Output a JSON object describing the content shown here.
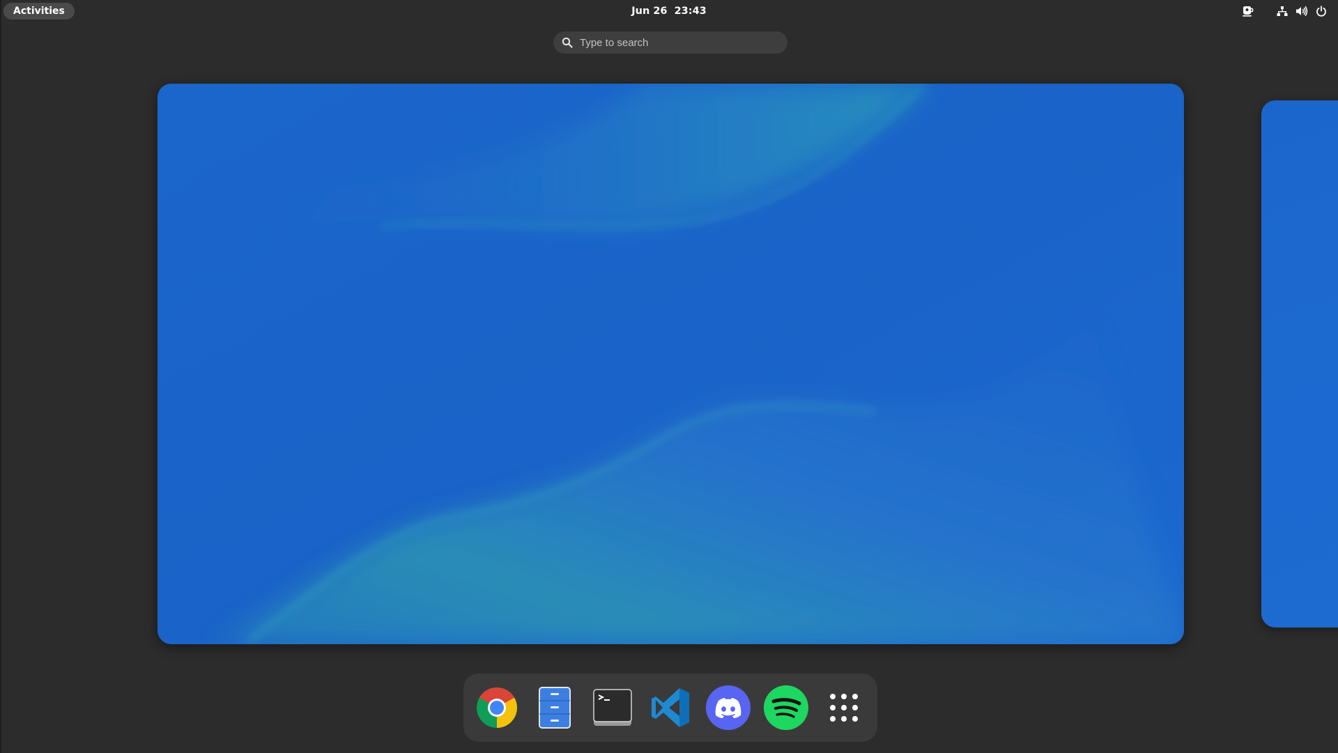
{
  "topbar": {
    "activities_label": "Activities",
    "clock": "Jun 26  23:43",
    "tray": {
      "left_icon": "coffee-cup-icon",
      "icons": [
        "network-icon",
        "volume-icon",
        "power-icon"
      ]
    }
  },
  "search": {
    "placeholder": "Type to search",
    "value": ""
  },
  "workspaces": {
    "count_visible": 2,
    "wallpaper_colors": {
      "base": "#1b63c9",
      "highlight": "#2aa6a8"
    }
  },
  "dash": {
    "apps": [
      {
        "icon": "chrome-icon",
        "name": "Google Chrome"
      },
      {
        "icon": "file-cabinet-icon",
        "name": "Files"
      },
      {
        "icon": "terminal-icon",
        "name": "Terminal"
      },
      {
        "icon": "vscode-icon",
        "name": "Visual Studio Code"
      },
      {
        "icon": "discord-icon",
        "name": "Discord"
      },
      {
        "icon": "spotify-icon",
        "name": "Spotify"
      }
    ],
    "show_apps_icon": "app-grid-icon",
    "colors": {
      "chrome_red": "#db4437",
      "chrome_yellow": "#f4c20d",
      "chrome_green": "#0f9d58",
      "chrome_blue": "#4285f4",
      "files_blue": "#3d7fe0",
      "terminal_bg": "#2b2b2b",
      "vscode_blue": "#1f8ad2",
      "discord": "#5865f2",
      "spotify": "#1ed760"
    }
  }
}
